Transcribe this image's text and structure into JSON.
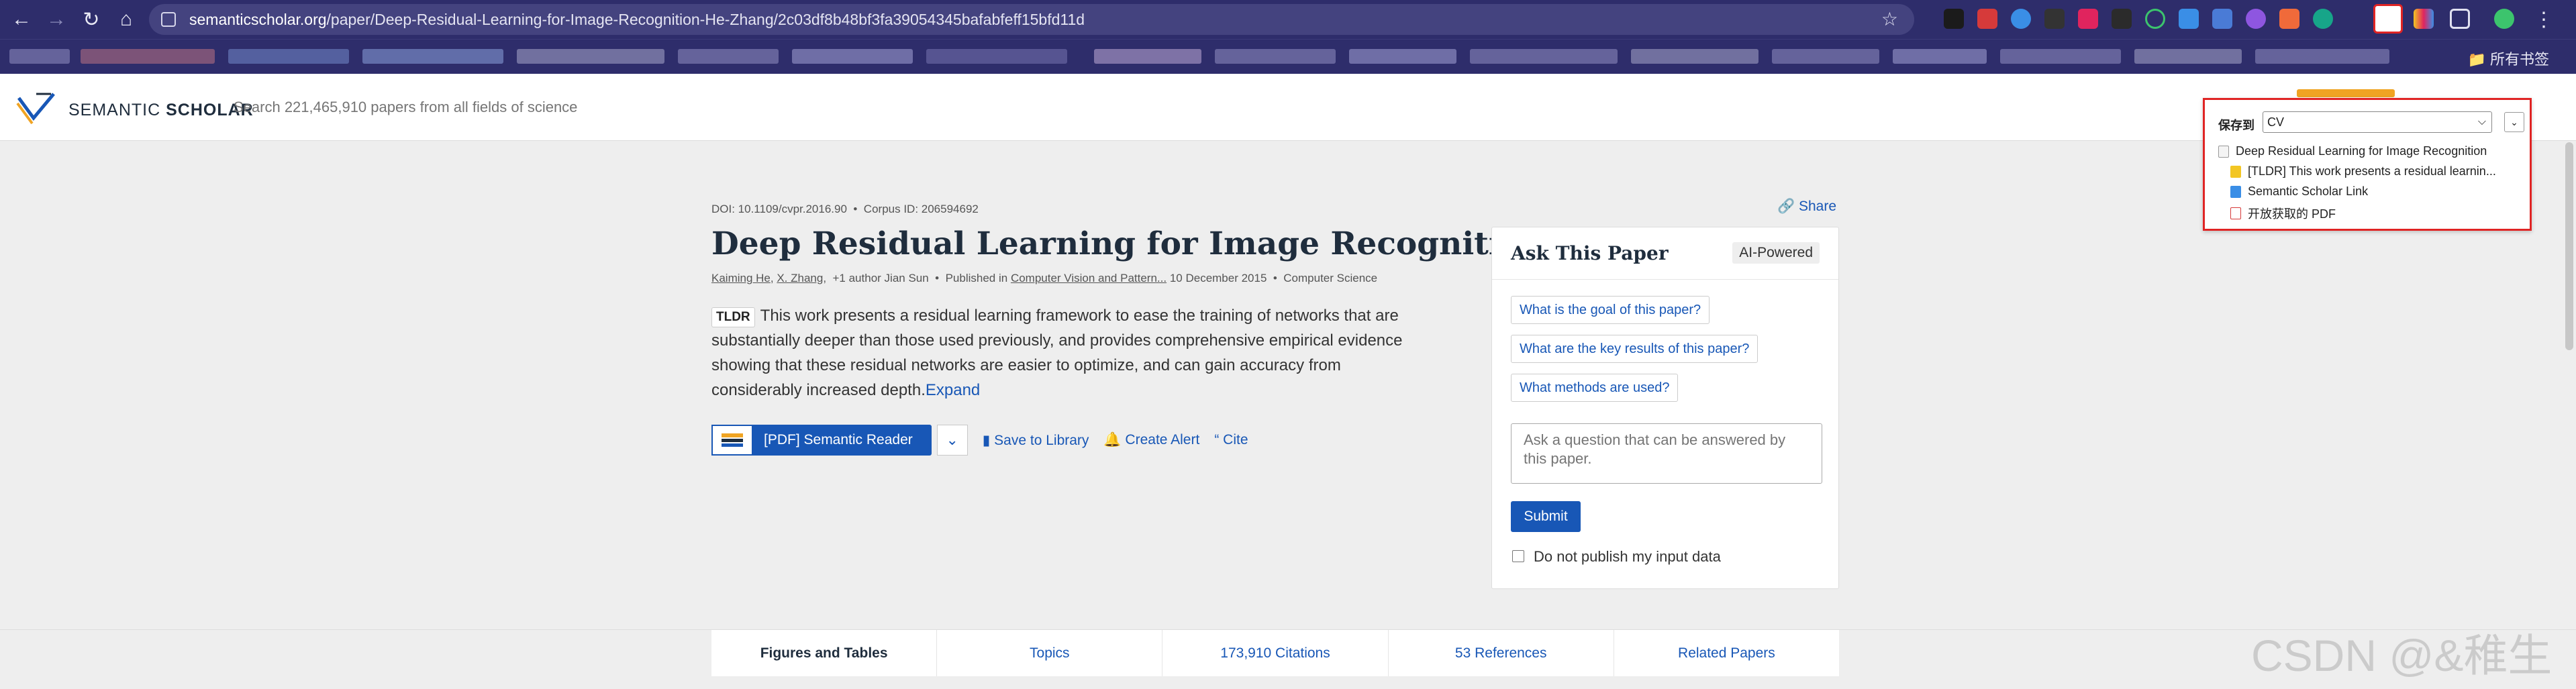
{
  "browser": {
    "url_host": "semanticscholar.org",
    "url_path": "/paper/Deep-Residual-Learning-for-Image-Recognition-He-Zhang/2c03df8b48bf3fa39054345bafabfeff15bfd11d",
    "bookmarks_all": "所有书签"
  },
  "site": {
    "logo_text_light": "SEMANTIC ",
    "logo_text_bold": "SCHOLAR",
    "search_placeholder": "Search 221,465,910 papers from all fields of science"
  },
  "paper": {
    "doi": "DOI: 10.1109/cvpr.2016.90",
    "corpus_id": "Corpus ID: 206594692",
    "share": "Share",
    "title": "Deep Residual Learning for Image Recognition",
    "authors": [
      "Kaiming He",
      "X. Zhang"
    ],
    "more_authors": "+1 author",
    "last_author": "Jian Sun",
    "published_prefix": "Published in",
    "venue": "Computer Vision and Pattern...",
    "date": "10 December 2015",
    "field": "Computer Science",
    "tldr_tag": "TLDR",
    "tldr_text": "This work presents a residual learning framework to ease the training of networks that are substantially deeper than those used previously, and provides comprehensive empirical evidence showing that these residual networks are easier to optimize, and can gain accuracy from considerably increased depth.",
    "expand": "Expand"
  },
  "actions": {
    "pdf_reader": "[PDF] Semantic Reader",
    "save_library": "Save to Library",
    "create_alert": "Create Alert",
    "cite": "Cite"
  },
  "ask": {
    "title": "Ask This Paper",
    "badge": "AI-Powered",
    "questions": [
      "What is the goal of this paper?",
      "What are the key results of this paper?",
      "What methods are used?"
    ],
    "input_placeholder": "Ask a question that can be answered by this paper.",
    "submit": "Submit",
    "checkbox_label": "Do not publish my input data"
  },
  "tabs": [
    {
      "label": "Figures and Tables",
      "active": true
    },
    {
      "label": "Topics",
      "active": false
    },
    {
      "label": "173,910 Citations",
      "active": false
    },
    {
      "label": "53 References",
      "active": false
    },
    {
      "label": "Related Papers",
      "active": false
    }
  ],
  "popup": {
    "save_to": "保存到",
    "folder": "CV",
    "items": [
      "Deep Residual Learning for Image Recognition",
      "[TLDR] This work presents a residual learnin...",
      "Semantic Scholar Link",
      "开放获取的 PDF"
    ]
  },
  "watermark": "CSDN @&稚生",
  "colors": {
    "browser_bg": "#2e2d6b",
    "link": "#1857b6",
    "popup_border": "#e02424",
    "page_bg": "#eeeeee"
  },
  "icons": [
    "back-arrow-icon",
    "forward-arrow-icon",
    "reload-icon",
    "home-icon",
    "site-info-icon",
    "bookmark-star-icon",
    "folder-icon",
    "link-icon",
    "share-icon",
    "bookmark-icon",
    "bell-icon",
    "quote-icon",
    "chevron-down-icon",
    "document-icon",
    "pdf-icon"
  ]
}
